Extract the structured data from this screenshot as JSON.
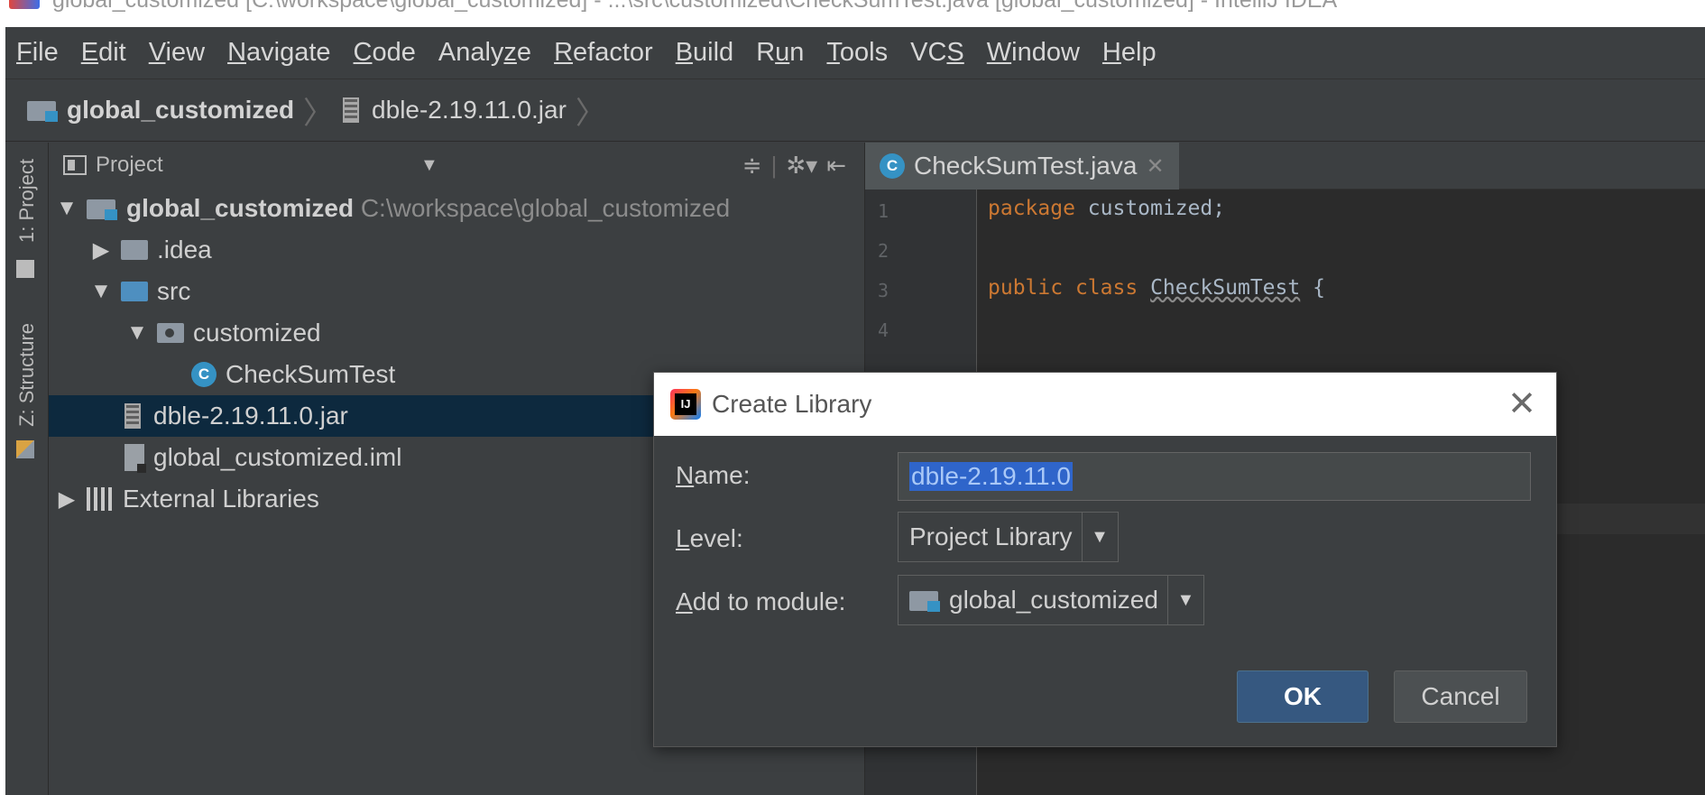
{
  "window_title": "global_customized [C:\\workspace\\global_customized] - ...\\src\\customized\\CheckSumTest.java [global_customized] - IntelliJ IDEA",
  "menu": [
    {
      "pre": "",
      "u": "F",
      "post": "ile"
    },
    {
      "pre": "",
      "u": "E",
      "post": "dit"
    },
    {
      "pre": "",
      "u": "V",
      "post": "iew"
    },
    {
      "pre": "",
      "u": "N",
      "post": "avigate"
    },
    {
      "pre": "",
      "u": "C",
      "post": "ode"
    },
    {
      "pre": "Analy",
      "u": "z",
      "post": "e"
    },
    {
      "pre": "",
      "u": "R",
      "post": "efactor"
    },
    {
      "pre": "",
      "u": "B",
      "post": "uild"
    },
    {
      "pre": "R",
      "u": "u",
      "post": "n"
    },
    {
      "pre": "",
      "u": "T",
      "post": "ools"
    },
    {
      "pre": "VC",
      "u": "S",
      "post": ""
    },
    {
      "pre": "",
      "u": "W",
      "post": "indow"
    },
    {
      "pre": "",
      "u": "H",
      "post": "elp"
    }
  ],
  "breadcrumb": {
    "project": "global_customized",
    "file": "dble-2.19.11.0.jar"
  },
  "tool_stripe": {
    "project_tab": "1: Project",
    "structure_tab": "Z: Structure"
  },
  "project_panel": {
    "title": "Project",
    "tree": [
      {
        "label": "global_customized",
        "path": "C:\\workspace\\global_customized",
        "icon": "module-folder-icon",
        "expanded": true
      },
      {
        "label": ".idea",
        "icon": "folder-icon",
        "expanded": false
      },
      {
        "label": "src",
        "icon": "source-folder-icon",
        "expanded": true
      },
      {
        "label": "customized",
        "icon": "package-icon",
        "expanded": true
      },
      {
        "label": "CheckSumTest",
        "icon": "class-icon"
      },
      {
        "label": "dble-2.19.11.0.jar",
        "icon": "jar-icon",
        "selected": true
      },
      {
        "label": "global_customized.iml",
        "icon": "iml-file-icon"
      },
      {
        "label": "External Libraries",
        "icon": "library-icon",
        "expanded": false
      }
    ]
  },
  "editor": {
    "tab": {
      "label": "CheckSumTest.java"
    },
    "line_numbers": [
      "1",
      "2",
      "3",
      "4"
    ],
    "code": {
      "line1_kw": "package",
      "line1_rest": " customized;",
      "line3_kw1": "public",
      "line3_kw2": "class",
      "line3_name": "CheckSumTest",
      "line3_rest": " {"
    }
  },
  "dialog": {
    "title": "Create Library",
    "name_label": {
      "u": "N",
      "rest": "ame:"
    },
    "name_value": "dble-2.19.11.0",
    "level_label": {
      "u": "L",
      "rest": "evel:"
    },
    "level_value": "Project Library",
    "module_label": {
      "u": "A",
      "rest": "dd to module:"
    },
    "module_value": "global_customized",
    "ok_label": "OK",
    "cancel_label": "Cancel"
  },
  "colors": {
    "selection": "#0d293e",
    "accent": "#3592c4",
    "ok_button": "#365880",
    "keyword": "#cc7832"
  }
}
